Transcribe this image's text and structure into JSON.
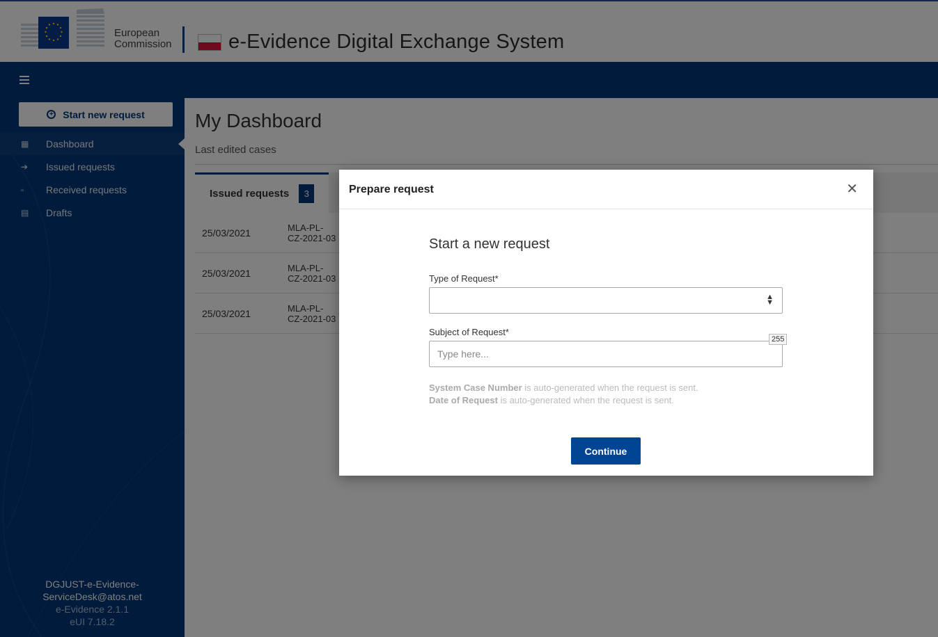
{
  "header": {
    "org_line1": "European",
    "org_line2": "Commission",
    "app_title": "e-Evidence Digital Exchange System"
  },
  "sidebar": {
    "start_button_label": "Start new request",
    "items": [
      {
        "label": "Dashboard",
        "icon": "grid-icon"
      },
      {
        "label": "Issued requests",
        "icon": "arrow-right-icon"
      },
      {
        "label": "Received requests",
        "icon": "inbox-icon"
      },
      {
        "label": "Drafts",
        "icon": "document-icon"
      }
    ],
    "footer": {
      "email_line1": "DGJUST-e-Evidence-",
      "email_line2": "ServiceDesk@atos.net",
      "version": "e-Evidence 2.1.1",
      "eui_version": "eUI 7.18.2"
    }
  },
  "main": {
    "title": "My Dashboard",
    "subtitle": "Last edited cases",
    "tab": {
      "label": "Issued requests",
      "count": "3"
    },
    "rows": [
      {
        "date": "25/03/2021",
        "ref_line1": "MLA-PL-",
        "ref_line2": "CZ-2021-03"
      },
      {
        "date": "25/03/2021",
        "ref_line1": "MLA-PL-",
        "ref_line2": "CZ-2021-03"
      },
      {
        "date": "25/03/2021",
        "ref_line1": "MLA-PL-",
        "ref_line2": "CZ-2021-03"
      }
    ]
  },
  "modal": {
    "title": "Prepare request",
    "section_title": "Start a new request",
    "type_label": "Type of Request*",
    "type_value": "",
    "subject_label": "Subject of Request*",
    "subject_placeholder": "Type here...",
    "subject_value": "",
    "char_count": "255",
    "hint1_bold": "System Case Number",
    "hint1_rest": " is auto-generated when the request is sent.",
    "hint2_bold": "Date of Request",
    "hint2_rest": " is auto-generated when the request is sent.",
    "continue_label": "Continue"
  },
  "colors": {
    "brand_navy": "#003776",
    "button_blue": "#004494",
    "flag_red": "#dc143c"
  }
}
